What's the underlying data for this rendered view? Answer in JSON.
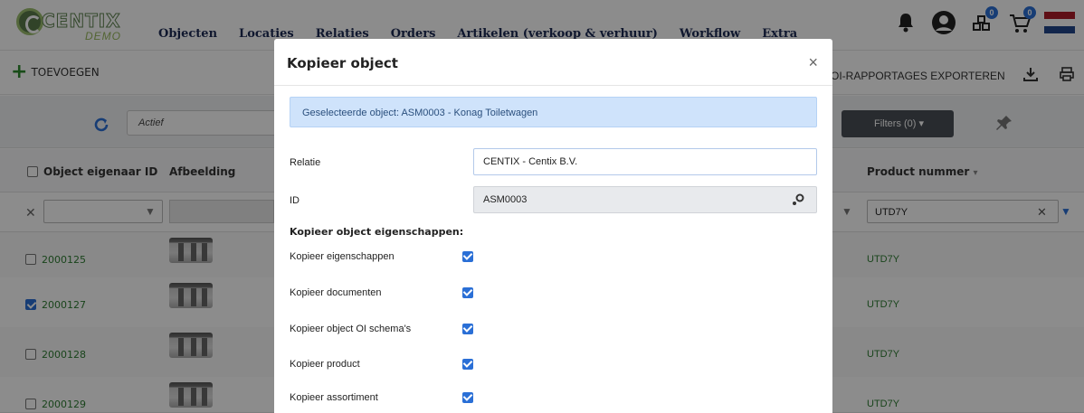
{
  "app": {
    "logo_text": "CENTIX",
    "logo_sub": "DEMO",
    "nav": [
      "Objecten",
      "Locaties",
      "Relaties",
      "Orders",
      "Artikelen (verkoop & verhuur)",
      "Workflow",
      "Extra"
    ],
    "badges": {
      "assets": "0",
      "cart": "0"
    }
  },
  "toolbar": {
    "add_label": "TOEVOEGEN",
    "export_label": "OI-RAPPORTAGES EXPORTEREN"
  },
  "filterbar": {
    "status_value": "Actief",
    "filters_label": "Filters (0) ▾"
  },
  "table": {
    "columns": {
      "owner_id": "Object eigenaar ID",
      "image": "Afbeelding",
      "product_number": "Product nummer"
    },
    "product_filter_value": "UTD7Y",
    "rows": [
      {
        "id": "2000125",
        "checked": false,
        "product": "UTD7Y"
      },
      {
        "id": "2000127",
        "checked": true,
        "product": "UTD7Y"
      },
      {
        "id": "2000128",
        "checked": false,
        "product": "UTD7Y"
      },
      {
        "id": "2000129",
        "checked": false,
        "product": "UTD7Y"
      }
    ]
  },
  "modal": {
    "title": "Kopieer object",
    "close": "×",
    "alert": "Geselecteerde object: ASM0003 - Konag Toiletwagen",
    "relatie_label": "Relatie",
    "relatie_value": "CENTIX - Centix B.V.",
    "id_label": "ID",
    "id_value": "ASM0003",
    "section_title": "Kopieer object eigenschappen:",
    "options": [
      {
        "label": "Kopieer eigenschappen",
        "checked": true
      },
      {
        "label": "Kopieer documenten",
        "checked": true
      },
      {
        "label": "Kopieer object OI schema's",
        "checked": true
      },
      {
        "label": "Kopieer product",
        "checked": true
      },
      {
        "label": "Kopieer assortiment",
        "checked": true
      }
    ]
  },
  "colors": {
    "accent": "#2a6fd6",
    "green": "#2e7d32",
    "nav": "#1d2a55"
  }
}
